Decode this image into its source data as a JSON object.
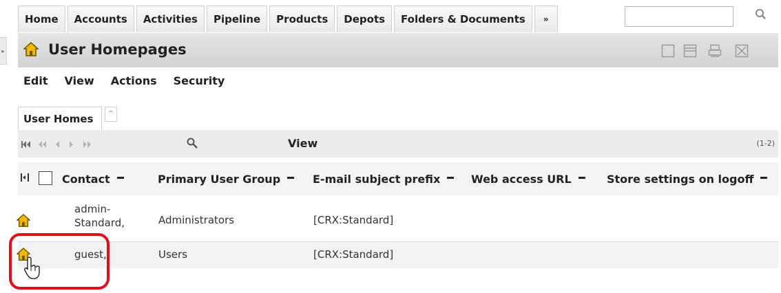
{
  "nav": {
    "tabs": [
      "Home",
      "Accounts",
      "Activities",
      "Pipeline",
      "Products",
      "Depots",
      "Folders & Documents"
    ],
    "more_label": "»",
    "search_value": ""
  },
  "title": "User Homepages",
  "menu": [
    "Edit",
    "View",
    "Actions",
    "Security"
  ],
  "subtab": {
    "label": "User Homes",
    "collapse": "^"
  },
  "pager": {
    "view_label": "View",
    "record_count": "(1-2)"
  },
  "table": {
    "columns": [
      "Contact",
      "Primary User Group",
      "E-mail subject prefix",
      "Web access URL",
      "Store settings on logoff"
    ],
    "rows": [
      {
        "contact_line1": "admin-",
        "contact_line2": "Standard,",
        "group": "Administrators",
        "prefix": "[CRX:Standard]",
        "url": "",
        "store": ""
      },
      {
        "contact_line1": "guest,",
        "contact_line2": "",
        "group": "Users",
        "prefix": "[CRX:Standard]",
        "url": "",
        "store": ""
      }
    ]
  },
  "colors": {
    "highlight": "#e0101a",
    "home_icon": "#f2b800",
    "title_bar": "#d9d9d9"
  },
  "icons": {
    "row_icon": "home-icon",
    "search": "magnifier-icon"
  }
}
